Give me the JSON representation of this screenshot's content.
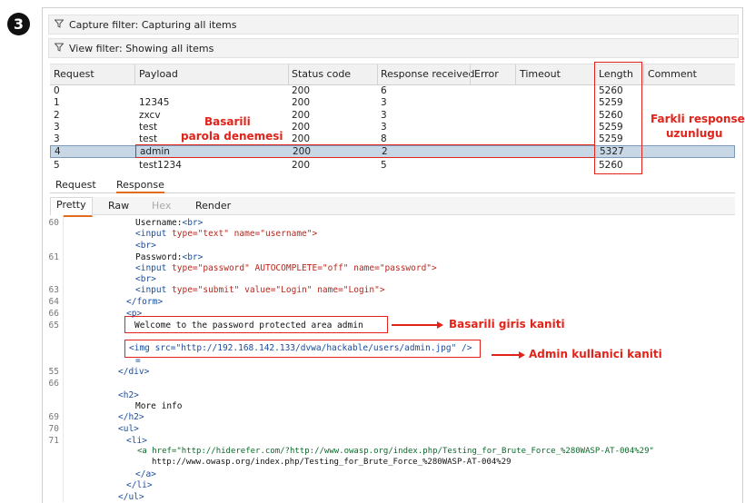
{
  "step_badge": "3",
  "filters": {
    "capture": "Capture filter: Capturing all items",
    "view": "View filter: Showing all items"
  },
  "table": {
    "headers": [
      "Request",
      "Payload",
      "Status code",
      "Response received",
      "Error",
      "Timeout",
      "Length",
      "Comment"
    ],
    "rows": [
      {
        "request": "0",
        "payload": "",
        "status": "200",
        "received": "6",
        "length": "5260"
      },
      {
        "request": "1",
        "payload": "12345",
        "status": "200",
        "received": "3",
        "length": "5259"
      },
      {
        "request": "2",
        "payload": "zxcv",
        "status": "200",
        "received": "3",
        "length": "5260"
      },
      {
        "request": "3",
        "payload": "test",
        "status": "200",
        "received": "3",
        "length": "5259"
      },
      {
        "request": "3",
        "payload": "test",
        "status": "200",
        "received": "8",
        "length": "5259"
      },
      {
        "request": "4",
        "payload": "admin",
        "status": "200",
        "received": "2",
        "length": "5327"
      },
      {
        "request": "5",
        "payload": "test1234",
        "status": "200",
        "received": "5",
        "length": "5260"
      }
    ]
  },
  "tabs_top": {
    "request": "Request",
    "response": "Response"
  },
  "tabs_view": {
    "pretty": "Pretty",
    "raw": "Raw",
    "hex": "Hex",
    "render": "Render"
  },
  "code": {
    "line_numbers": [
      "60",
      "61",
      "63",
      "64",
      "66",
      "65",
      "55",
      "66",
      "69",
      "70",
      "71"
    ],
    "lines": {
      "username_label": "Username:",
      "br": "<br>",
      "input_user_tag": "<input ",
      "input_user_attrs": "type=\"text\" name=\"username\">",
      "password_label": "Password:",
      "input_pass_tag": "<input ",
      "input_pass_attrs": "type=\"password\" AUTOCOMPLETE=\"off\" name=\"password\">",
      "input_submit_tag": "<input ",
      "input_submit_attrs": "type=\"submit\" value=\"Login\" name=\"Login\">",
      "form_close": "</form>",
      "p_open": "<p>",
      "welcome": "Welcome to the password protected area admin",
      "img_tag": "<img src=\"http://192.168.142.133/dvwa/hackable/users/admin.jpg\" />",
      "dash": "=",
      "div_close": "</div>",
      "h2_open": "<h2>",
      "more_info": "More info",
      "h2_close": "</h2>",
      "ul_open": "<ul>",
      "li_open": "<li>",
      "a_href": "<a href=\"http://hiderefer.com/?http://www.owasp.org/index.php/Testing_for_Brute_Force_%280WASP-AT-004%29\"",
      "a_text": "http://www.owasp.org/index.php/Testing_for_Brute_Force_%280WASP-AT-004%29",
      "a_close": "</a>",
      "li_close": "</li>",
      "ul_close": "</ul>"
    }
  },
  "annotations": {
    "basarili_line1": "Basarili",
    "basarili_line2": "parola denemesi",
    "farkli_line1": "Farkli response",
    "farkli_line2": "uzunlugu",
    "giris": "Basarili giris kaniti",
    "admin": "Admin kullanici kaniti"
  },
  "colors": {
    "annotation_red": "#e2231a",
    "selected_row": "#c7d7e6",
    "tab_accent": "#e06c1f"
  }
}
